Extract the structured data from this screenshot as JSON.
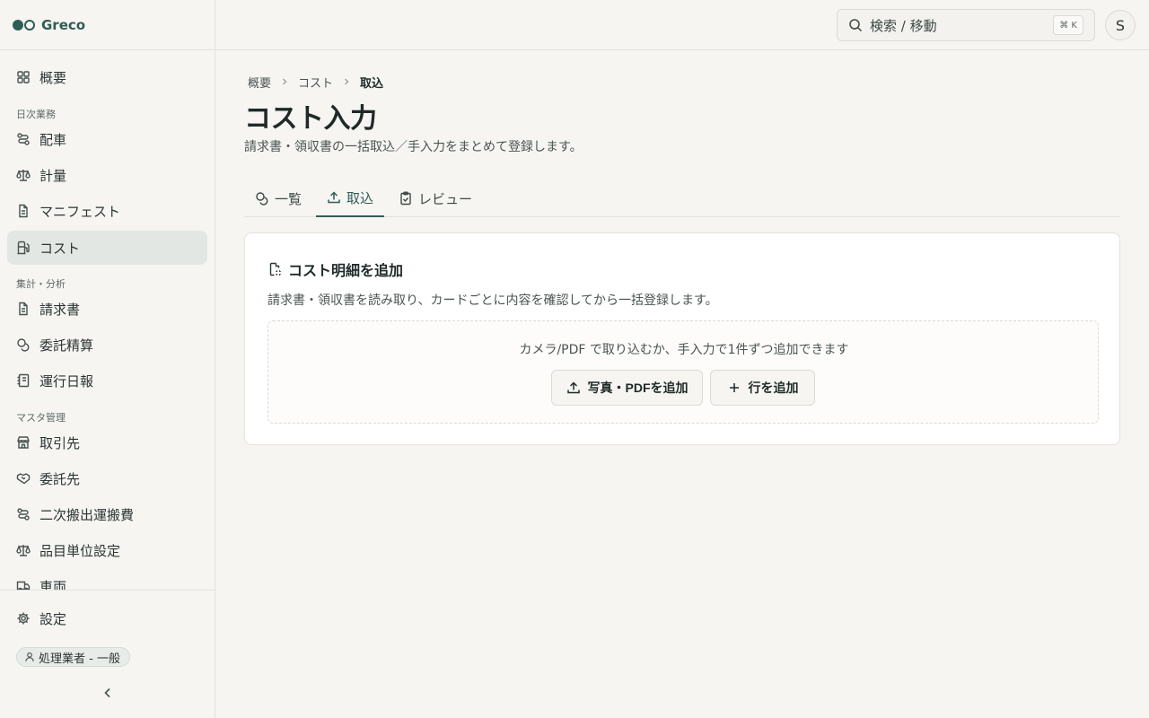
{
  "brand": {
    "name": "Greco"
  },
  "sidebar": {
    "overview": "概要",
    "groups": [
      "日次業務",
      "集計・分析",
      "マスタ管理"
    ],
    "daily": [
      "配車",
      "計量",
      "マニフェスト",
      "コスト"
    ],
    "analysis": [
      "請求書",
      "委託精算",
      "運行日報"
    ],
    "master": [
      "取引先",
      "委託先",
      "二次搬出運搬費",
      "品目単位設定",
      "車両"
    ],
    "active": "コスト",
    "settings": "設定",
    "role": "処理業者 - 一般"
  },
  "topbar": {
    "search_placeholder": "検索 / 移動",
    "shortcut": "⌘ K",
    "avatar": "S"
  },
  "breadcrumb": [
    "概要",
    "コスト",
    "取込"
  ],
  "page": {
    "title": "コスト入力",
    "description": "請求書・領収書の一括取込／手入力をまとめて登録します。"
  },
  "tabs": [
    "一覧",
    "取込",
    "レビュー"
  ],
  "active_tab": "取込",
  "card": {
    "title": "コスト明細を追加",
    "description": "請求書・領収書を読み取り、カードごとに内容を確認してから一括登録します。",
    "dropzone_text": "カメラ/PDF で取り込むか、手入力で1件ずつ追加できます",
    "upload_button": "写真・PDFを追加",
    "add_row_button": "行を追加"
  },
  "colors": {
    "accent": "#2f5d55",
    "active_bg": "#e3e7e3",
    "background": "#f6f5f2",
    "card": "#ffffff"
  }
}
